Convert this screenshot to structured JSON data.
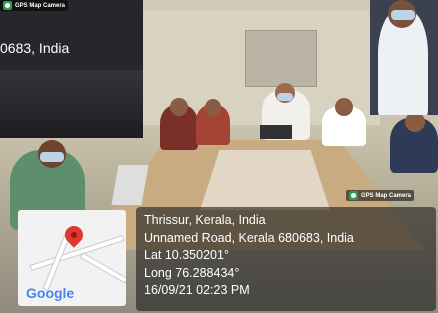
{
  "camera_badge": "GPS Map Camera",
  "left_inset": {
    "address_fragment": "0683, India"
  },
  "map": {
    "logo_text": "Google"
  },
  "location": {
    "city_line": "Thrissur, Kerala, India",
    "address_line": "Unnamed Road, Kerala 680683, India",
    "lat_line": "Lat 10.350201°",
    "long_line": "Long 76.288434°",
    "datetime_line": "16/09/21 02:23 PM"
  },
  "colors": {
    "pin": "#e0382f",
    "badge_icon": "#2e9e4f",
    "panel": "#1e1e1e"
  }
}
